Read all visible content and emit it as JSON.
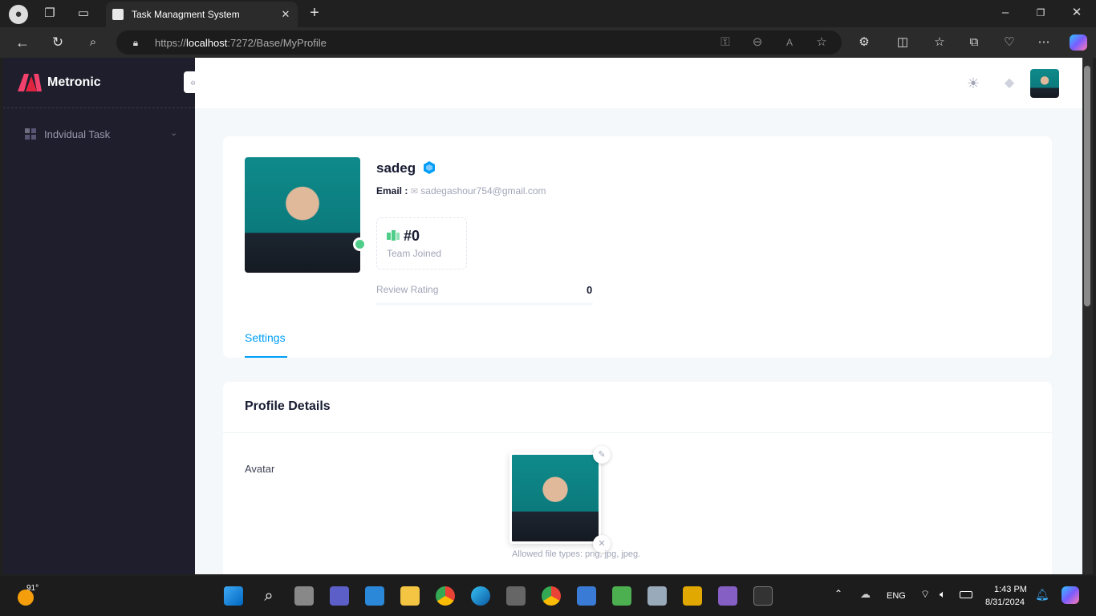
{
  "browser": {
    "tab_title": "Task Managment System",
    "url_prefix": "https://",
    "url_host": "localhost",
    "url_rest": ":7272/Base/MyProfile"
  },
  "app": {
    "brand": "Metronic",
    "sidebar_items": [
      {
        "label": "Indvidual Task"
      }
    ]
  },
  "profile": {
    "name": "sadeg",
    "email_label": "Email :",
    "email": "sadegashour754@gmail.com",
    "stat_value": "#0",
    "stat_label": "Team Joined",
    "rating_label": "Review Rating",
    "rating_value": "0",
    "tab": "Settings"
  },
  "details": {
    "title": "Profile Details",
    "avatar_label": "Avatar",
    "allowed": "Allowed file types: png, jpg, jpeg."
  },
  "taskbar": {
    "weather": "91°",
    "lang": "ENG",
    "time": "1:43 PM",
    "date": "8/31/2024"
  },
  "colors": {
    "accent": "#009ef7",
    "sidebar": "#1e1e2d",
    "online": "#50cd89"
  }
}
